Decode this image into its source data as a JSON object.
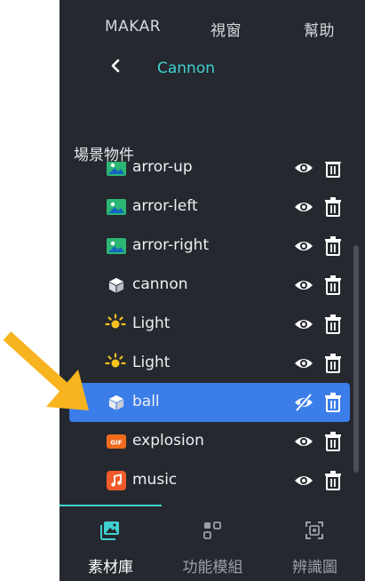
{
  "menu": {
    "items": [
      {
        "label": "MAKAR"
      },
      {
        "label": "視窗"
      },
      {
        "label": "幫助"
      }
    ]
  },
  "breadcrumb": {
    "title": "Cannon"
  },
  "section": {
    "title": "場景物件"
  },
  "objects": [
    {
      "label": "arror-up",
      "icon": "image-icon",
      "visible": true
    },
    {
      "label": "arror-left",
      "icon": "image-icon",
      "visible": true
    },
    {
      "label": "arror-right",
      "icon": "image-icon",
      "visible": true
    },
    {
      "label": "cannon",
      "icon": "cube-icon",
      "visible": true
    },
    {
      "label": "Light",
      "icon": "light-icon",
      "visible": true
    },
    {
      "label": "Light",
      "icon": "light-icon",
      "visible": true
    },
    {
      "label": "ball",
      "icon": "cube-icon",
      "visible": false,
      "selected": true
    },
    {
      "label": "explosion",
      "icon": "gif-icon",
      "visible": true
    },
    {
      "label": "music",
      "icon": "music-icon",
      "visible": true
    }
  ],
  "tabs": [
    {
      "label": "素材庫",
      "icon": "media-library-icon",
      "active": true
    },
    {
      "label": "功能模組",
      "icon": "modules-icon",
      "active": false
    },
    {
      "label": "辨識圖",
      "icon": "target-image-icon",
      "active": false
    }
  ],
  "colors": {
    "panel": "#25292f",
    "accent": "#3fd1cf",
    "selected": "#3b7de9",
    "arrow": "#f7b41e"
  }
}
